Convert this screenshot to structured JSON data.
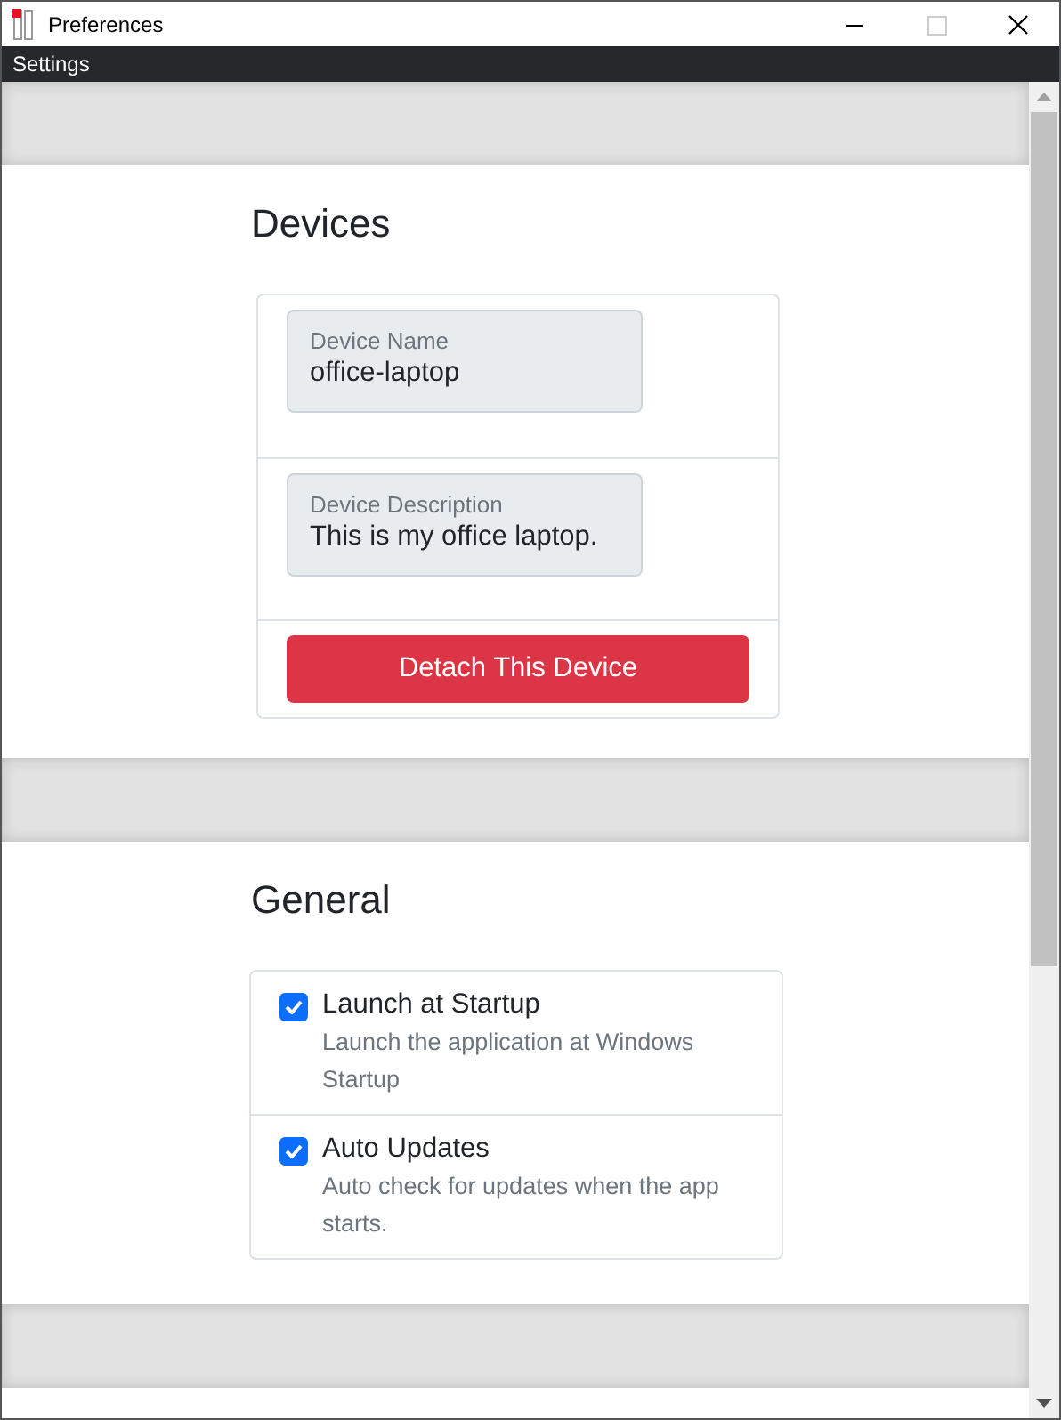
{
  "window": {
    "title": "Preferences"
  },
  "menu_bar": {
    "items": [
      "Settings"
    ]
  },
  "sections": [
    {
      "kind": "device",
      "title": "Devices",
      "fields": [
        {
          "label": "Device Name",
          "value": "office-laptop"
        },
        {
          "label": "Device Description",
          "value": "This is my office laptop."
        }
      ],
      "button": "Detach This Device"
    },
    {
      "kind": "options",
      "title": "General",
      "options": [
        {
          "label": "Launch at Startup",
          "description": "Launch the application at Windows Startup",
          "checked": true
        },
        {
          "label": "Auto Updates",
          "description": "Auto check for updates when the app starts.",
          "checked": true
        }
      ]
    }
  ]
}
